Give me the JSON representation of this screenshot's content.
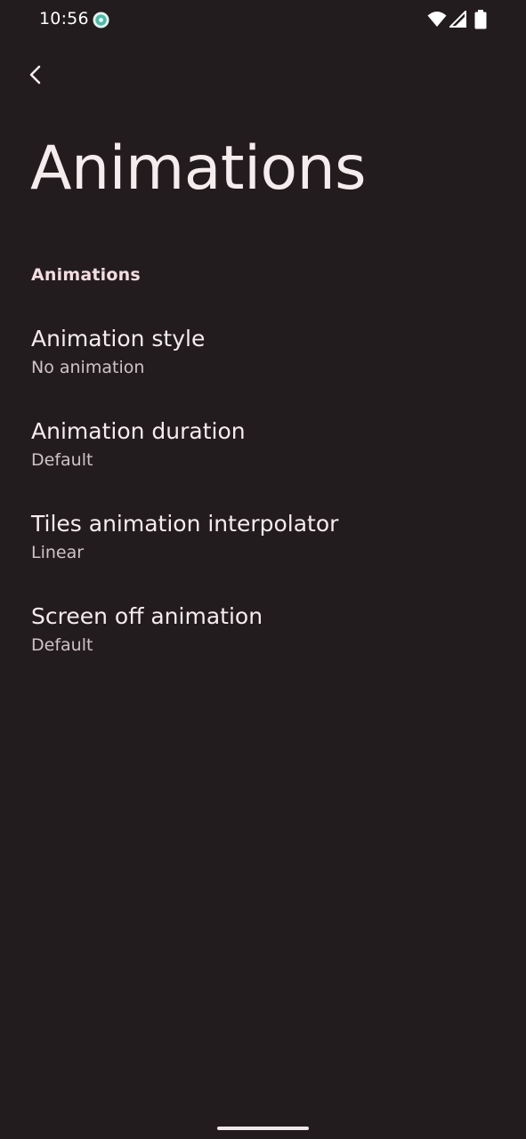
{
  "status_bar": {
    "time": "10:56",
    "icons": [
      "app-notification-icon",
      "wifi-icon",
      "cell-signal-icon",
      "battery-icon"
    ]
  },
  "toolbar": {
    "back_icon": "arrow-back-icon"
  },
  "page": {
    "title": "Animations"
  },
  "section": {
    "header": "Animations",
    "items": [
      {
        "title": "Animation style",
        "summary": "No animation"
      },
      {
        "title": "Animation duration",
        "summary": "Default"
      },
      {
        "title": "Tiles animation interpolator",
        "summary": "Linear"
      },
      {
        "title": "Screen off animation",
        "summary": "Default"
      }
    ]
  },
  "colors": {
    "background": "#231c1e",
    "primary_text": "#f4eced",
    "secondary_text": "#cfc3c6",
    "section_header": "#f3dde2",
    "notification_icon": "#4fb8a8"
  }
}
